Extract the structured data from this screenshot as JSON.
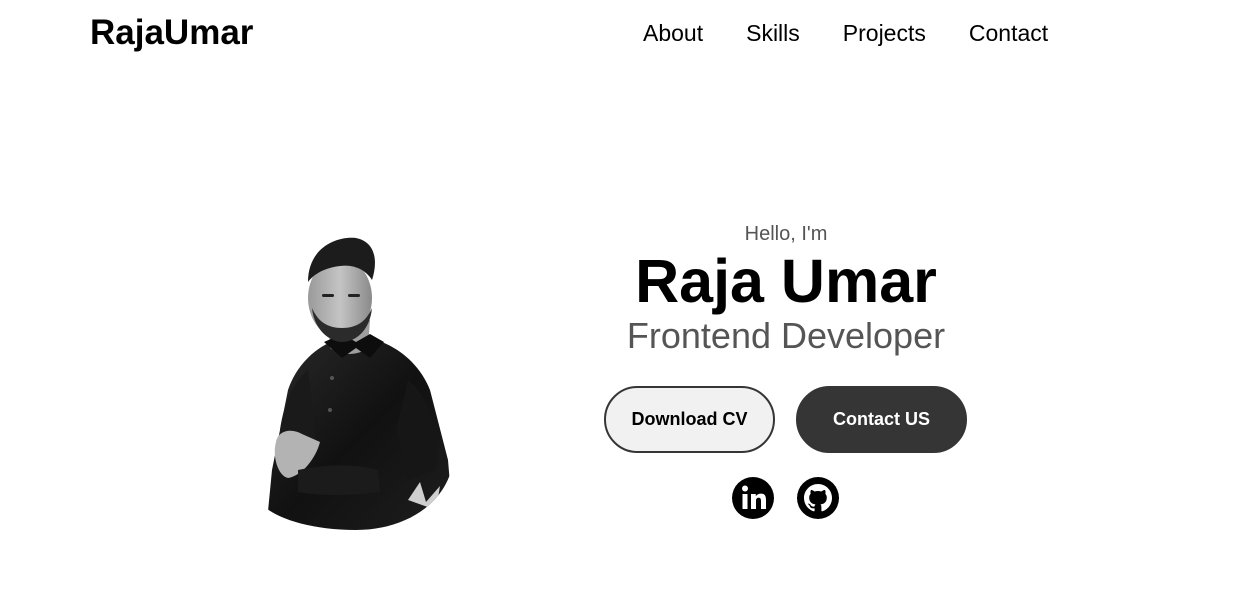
{
  "nav": {
    "logo": "RajaUmar",
    "links": [
      {
        "label": "About"
      },
      {
        "label": "Skills"
      },
      {
        "label": "Projects"
      },
      {
        "label": "Contact"
      }
    ]
  },
  "hero": {
    "greeting": "Hello, I'm",
    "name": "Raja Umar",
    "role": "Frontend Developer",
    "buttons": {
      "download_cv": "Download CV",
      "contact": "Contact US"
    },
    "socials": [
      {
        "icon": "linkedin-icon"
      },
      {
        "icon": "github-icon"
      }
    ]
  },
  "colors": {
    "text": "#000000",
    "muted": "#555555",
    "dark_button": "#353535",
    "light_button": "#f1f1f1",
    "background": "#ffffff"
  }
}
